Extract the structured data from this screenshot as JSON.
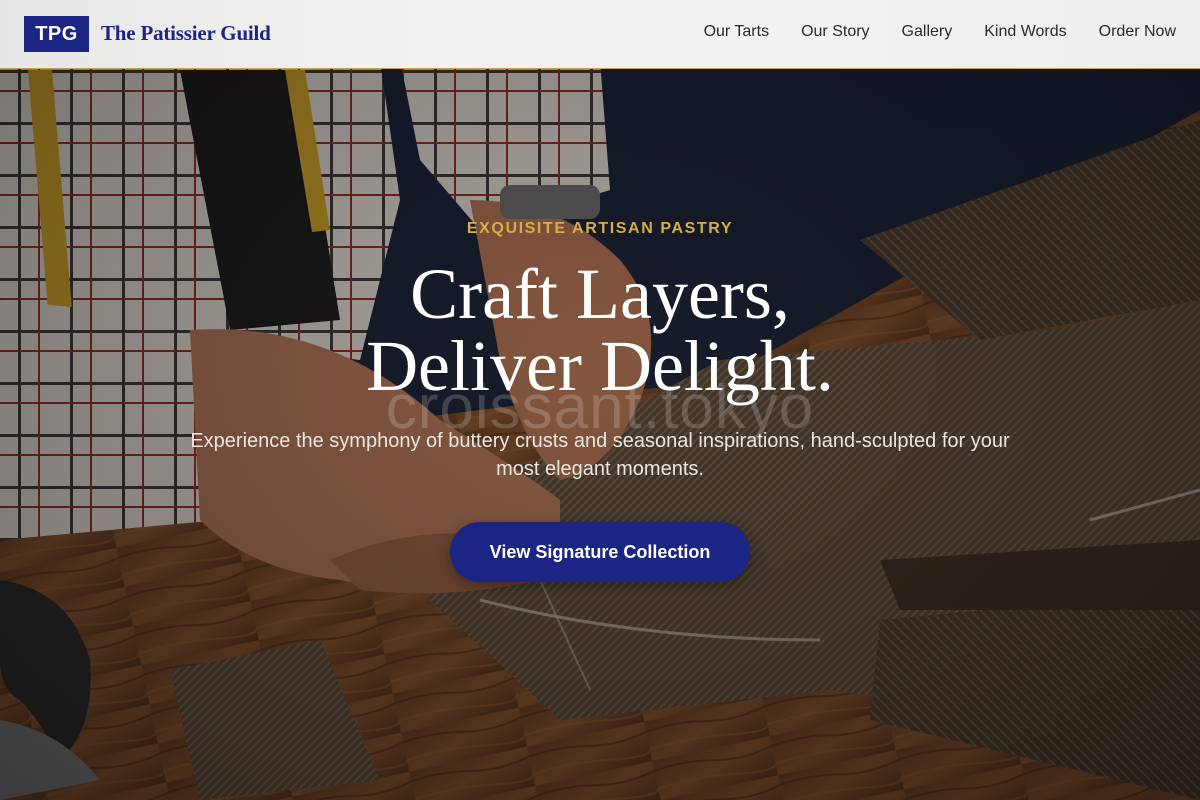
{
  "header": {
    "logo_text": "TPG",
    "brand_name": "The Patissier Guild",
    "nav": [
      {
        "label": "Our Tarts"
      },
      {
        "label": "Our Story"
      },
      {
        "label": "Gallery"
      },
      {
        "label": "Kind Words"
      },
      {
        "label": "Order Now"
      }
    ]
  },
  "hero": {
    "eyebrow": "EXQUISITE ARTISAN PASTRY",
    "headline_line1": "Craft Layers,",
    "headline_line2": "Deliver Delight.",
    "watermark": "croissant.tokyo",
    "subtext": "Experience the symphony of buttery crusts and seasonal inspirations, hand-sculpted for your most elegant moments.",
    "cta_label": "View Signature Collection"
  },
  "colors": {
    "brand_navy": "#1c2583",
    "accent_gold": "#d6ad48",
    "header_bg": "#f1f1f0"
  }
}
